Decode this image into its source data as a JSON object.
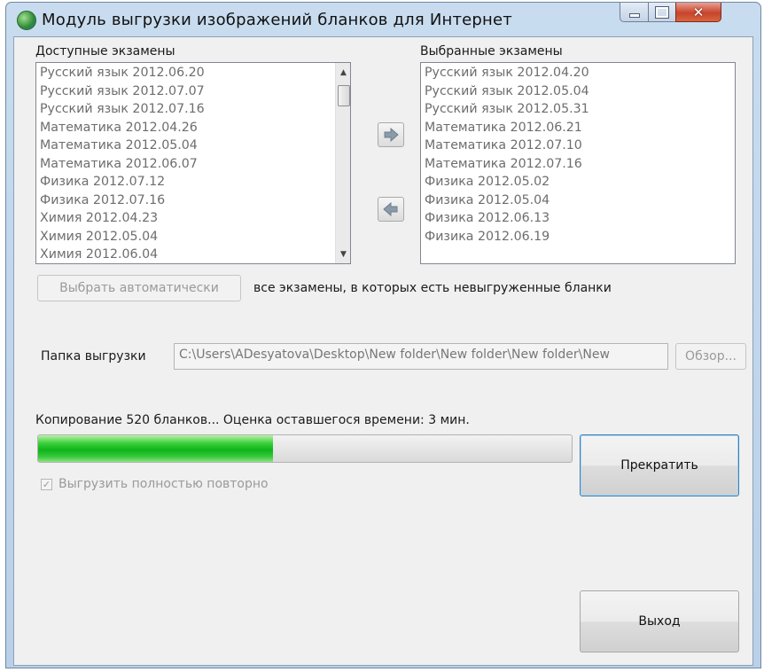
{
  "window": {
    "title": "Модуль выгрузки изображений бланков для Интернет"
  },
  "available": {
    "label": "Доступные экзамены",
    "items": [
      "Русский язык 2012.06.20",
      "Русский язык 2012.07.07",
      "Русский язык 2012.07.16",
      "Математика 2012.04.26",
      "Математика 2012.05.04",
      "Математика 2012.06.07",
      "Физика 2012.07.12",
      "Физика 2012.07.16",
      "Химия 2012.04.23",
      "Химия 2012.05.04",
      "Химия 2012.06.04"
    ]
  },
  "selected": {
    "label": "Выбранные экзамены",
    "items": [
      "Русский язык 2012.04.20",
      "Русский язык 2012.05.04",
      "Русский язык 2012.05.31",
      "Математика 2012.06.21",
      "Математика 2012.07.10",
      "Математика 2012.07.16",
      "Физика 2012.05.02",
      "Физика 2012.05.04",
      "Физика 2012.06.13",
      "Физика 2012.06.19"
    ]
  },
  "auto_select": {
    "button_label": "Выбрать автоматически",
    "description": "все экзамены, в которых есть невыгруженные бланки"
  },
  "output_folder": {
    "label": "Папка выгрузки",
    "value": "C:\\Users\\ADesyatova\\Desktop\\New folder\\New folder\\New folder\\New",
    "browse_label": "Обзор..."
  },
  "progress": {
    "status_text": "Копирование 520 бланков... Оценка оставшегося времени: 3 мин.",
    "fraction": 0.44,
    "stop_label": "Прекратить"
  },
  "options": {
    "reexport_label": "Выгрузить полностью повторно",
    "reexport_checked": true
  },
  "exit_label": "Выход",
  "colors": {
    "progress_green": "#0fb51a",
    "titlebar": "#c9dcef",
    "close_button": "#c7442c"
  },
  "icons": [
    "app-icon",
    "minimize-icon",
    "maximize-icon",
    "close-icon",
    "arrow-right-icon",
    "arrow-left-icon",
    "scroll-up-icon",
    "scroll-down-icon",
    "checkmark-icon"
  ]
}
